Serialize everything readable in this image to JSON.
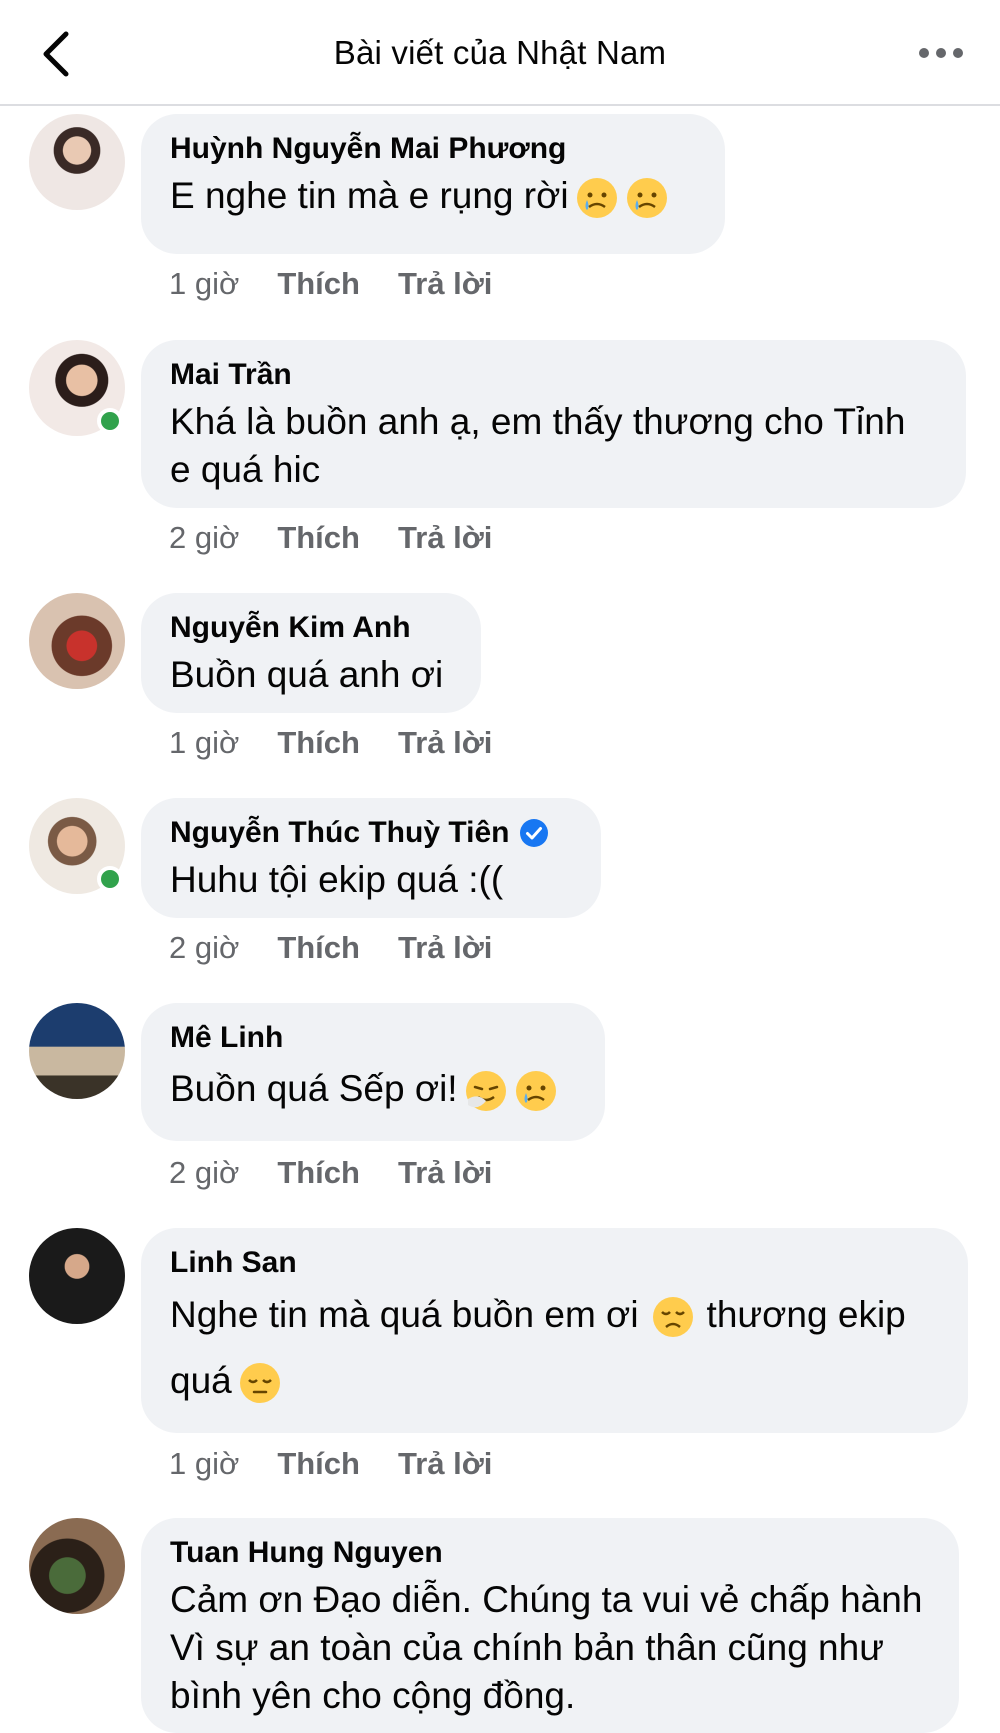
{
  "header": {
    "title": "Bài viết của Nhật Nam",
    "back_icon": "chevron-left-icon",
    "more_icon": "more-horizontal-icon"
  },
  "actions": {
    "like": "Thích",
    "reply": "Trả lời"
  },
  "comments": [
    {
      "author": "Huỳnh Nguyễn Mai Phương",
      "text": "E nghe tin mà e rụng rời",
      "emojis": [
        "crying-face",
        "crying-face"
      ],
      "time": "1 giờ",
      "online": false,
      "verified": false
    },
    {
      "author": "Mai Trần",
      "text": "Khá là buồn anh ạ, em thấy thương cho Tỉnh e quá hic",
      "emojis": [],
      "time": "2 giờ",
      "online": true,
      "verified": false
    },
    {
      "author": "Nguyễn Kim Anh",
      "text": "Buồn quá anh ơi",
      "emojis": [],
      "time": "1 giờ",
      "online": false,
      "verified": false
    },
    {
      "author": "Nguyễn Thúc Thuỳ Tiên",
      "text": "Huhu tội ekip quá :((",
      "emojis": [],
      "time": "2 giờ",
      "online": true,
      "verified": true
    },
    {
      "author": "Mê Linh",
      "text": "Buồn quá Sếp ơi!",
      "emojis": [
        "sneezing-face",
        "crying-face"
      ],
      "time": "2 giờ",
      "online": false,
      "verified": false
    },
    {
      "author": "Linh San",
      "text_part1": "Nghe tin mà quá buồn em ơi",
      "text_part2": "thương ekip quá",
      "emojis": [
        "disappointed-face",
        "pensive-face"
      ],
      "time": "1 giờ",
      "online": false,
      "verified": false
    },
    {
      "author": "Tuan Hung Nguyen",
      "text": "Cảm ơn Đạo diễn. Chúng ta vui vẻ chấp hành Vì sự an toàn của chính bản thân cũng như bình yên cho cộng đồng.",
      "emojis": [],
      "time": "",
      "online": false,
      "verified": false
    }
  ],
  "colors": {
    "bubble": "#f0f2f5",
    "meta": "#65676b",
    "online": "#31a24c",
    "verified": "#1877f2",
    "emoji": "#ffcc4d"
  }
}
